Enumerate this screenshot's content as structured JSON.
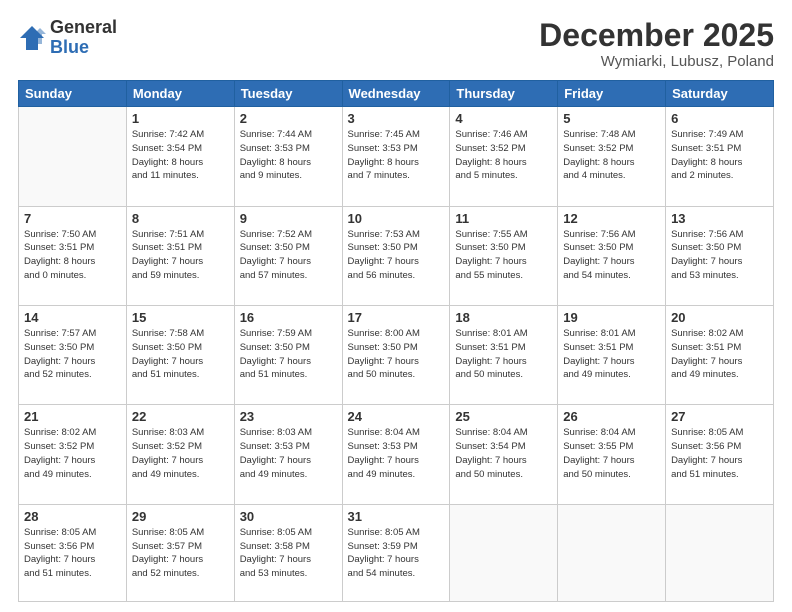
{
  "header": {
    "logo_line1": "General",
    "logo_line2": "Blue",
    "month": "December 2025",
    "location": "Wymiarki, Lubusz, Poland"
  },
  "weekdays": [
    "Sunday",
    "Monday",
    "Tuesday",
    "Wednesday",
    "Thursday",
    "Friday",
    "Saturday"
  ],
  "weeks": [
    [
      {
        "day": "",
        "info": ""
      },
      {
        "day": "1",
        "info": "Sunrise: 7:42 AM\nSunset: 3:54 PM\nDaylight: 8 hours\nand 11 minutes."
      },
      {
        "day": "2",
        "info": "Sunrise: 7:44 AM\nSunset: 3:53 PM\nDaylight: 8 hours\nand 9 minutes."
      },
      {
        "day": "3",
        "info": "Sunrise: 7:45 AM\nSunset: 3:53 PM\nDaylight: 8 hours\nand 7 minutes."
      },
      {
        "day": "4",
        "info": "Sunrise: 7:46 AM\nSunset: 3:52 PM\nDaylight: 8 hours\nand 5 minutes."
      },
      {
        "day": "5",
        "info": "Sunrise: 7:48 AM\nSunset: 3:52 PM\nDaylight: 8 hours\nand 4 minutes."
      },
      {
        "day": "6",
        "info": "Sunrise: 7:49 AM\nSunset: 3:51 PM\nDaylight: 8 hours\nand 2 minutes."
      }
    ],
    [
      {
        "day": "7",
        "info": "Sunrise: 7:50 AM\nSunset: 3:51 PM\nDaylight: 8 hours\nand 0 minutes."
      },
      {
        "day": "8",
        "info": "Sunrise: 7:51 AM\nSunset: 3:51 PM\nDaylight: 7 hours\nand 59 minutes."
      },
      {
        "day": "9",
        "info": "Sunrise: 7:52 AM\nSunset: 3:50 PM\nDaylight: 7 hours\nand 57 minutes."
      },
      {
        "day": "10",
        "info": "Sunrise: 7:53 AM\nSunset: 3:50 PM\nDaylight: 7 hours\nand 56 minutes."
      },
      {
        "day": "11",
        "info": "Sunrise: 7:55 AM\nSunset: 3:50 PM\nDaylight: 7 hours\nand 55 minutes."
      },
      {
        "day": "12",
        "info": "Sunrise: 7:56 AM\nSunset: 3:50 PM\nDaylight: 7 hours\nand 54 minutes."
      },
      {
        "day": "13",
        "info": "Sunrise: 7:56 AM\nSunset: 3:50 PM\nDaylight: 7 hours\nand 53 minutes."
      }
    ],
    [
      {
        "day": "14",
        "info": "Sunrise: 7:57 AM\nSunset: 3:50 PM\nDaylight: 7 hours\nand 52 minutes."
      },
      {
        "day": "15",
        "info": "Sunrise: 7:58 AM\nSunset: 3:50 PM\nDaylight: 7 hours\nand 51 minutes."
      },
      {
        "day": "16",
        "info": "Sunrise: 7:59 AM\nSunset: 3:50 PM\nDaylight: 7 hours\nand 51 minutes."
      },
      {
        "day": "17",
        "info": "Sunrise: 8:00 AM\nSunset: 3:50 PM\nDaylight: 7 hours\nand 50 minutes."
      },
      {
        "day": "18",
        "info": "Sunrise: 8:01 AM\nSunset: 3:51 PM\nDaylight: 7 hours\nand 50 minutes."
      },
      {
        "day": "19",
        "info": "Sunrise: 8:01 AM\nSunset: 3:51 PM\nDaylight: 7 hours\nand 49 minutes."
      },
      {
        "day": "20",
        "info": "Sunrise: 8:02 AM\nSunset: 3:51 PM\nDaylight: 7 hours\nand 49 minutes."
      }
    ],
    [
      {
        "day": "21",
        "info": "Sunrise: 8:02 AM\nSunset: 3:52 PM\nDaylight: 7 hours\nand 49 minutes."
      },
      {
        "day": "22",
        "info": "Sunrise: 8:03 AM\nSunset: 3:52 PM\nDaylight: 7 hours\nand 49 minutes."
      },
      {
        "day": "23",
        "info": "Sunrise: 8:03 AM\nSunset: 3:53 PM\nDaylight: 7 hours\nand 49 minutes."
      },
      {
        "day": "24",
        "info": "Sunrise: 8:04 AM\nSunset: 3:53 PM\nDaylight: 7 hours\nand 49 minutes."
      },
      {
        "day": "25",
        "info": "Sunrise: 8:04 AM\nSunset: 3:54 PM\nDaylight: 7 hours\nand 50 minutes."
      },
      {
        "day": "26",
        "info": "Sunrise: 8:04 AM\nSunset: 3:55 PM\nDaylight: 7 hours\nand 50 minutes."
      },
      {
        "day": "27",
        "info": "Sunrise: 8:05 AM\nSunset: 3:56 PM\nDaylight: 7 hours\nand 51 minutes."
      }
    ],
    [
      {
        "day": "28",
        "info": "Sunrise: 8:05 AM\nSunset: 3:56 PM\nDaylight: 7 hours\nand 51 minutes."
      },
      {
        "day": "29",
        "info": "Sunrise: 8:05 AM\nSunset: 3:57 PM\nDaylight: 7 hours\nand 52 minutes."
      },
      {
        "day": "30",
        "info": "Sunrise: 8:05 AM\nSunset: 3:58 PM\nDaylight: 7 hours\nand 53 minutes."
      },
      {
        "day": "31",
        "info": "Sunrise: 8:05 AM\nSunset: 3:59 PM\nDaylight: 7 hours\nand 54 minutes."
      },
      {
        "day": "",
        "info": ""
      },
      {
        "day": "",
        "info": ""
      },
      {
        "day": "",
        "info": ""
      }
    ]
  ]
}
